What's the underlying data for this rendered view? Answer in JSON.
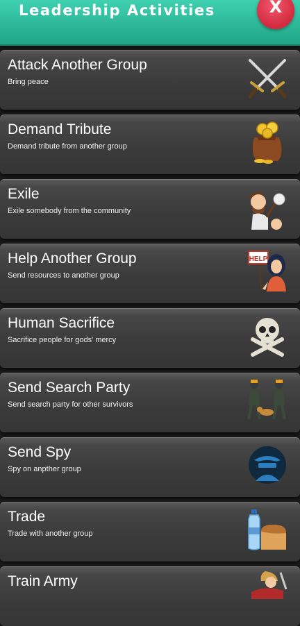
{
  "header": {
    "title": "Leadership Activities",
    "close_label": "X"
  },
  "activities": [
    {
      "title": "Attack Another Group",
      "description": "Bring peace",
      "icon": "crossed-swords-icon"
    },
    {
      "title": "Demand Tribute",
      "description": "Demand tribute from another group",
      "icon": "gold-sack-icon"
    },
    {
      "title": "Exile",
      "description": "Exile somebody from the community",
      "icon": "exiled-person-icon"
    },
    {
      "title": "Help Another Group",
      "description": "Send resources to another group",
      "icon": "help-sign-person-icon",
      "icon_text": "HELP"
    },
    {
      "title": "Human Sacrifice",
      "description": "Sacrifice people for gods' mercy",
      "icon": "skull-crossbones-icon"
    },
    {
      "title": "Send Search Party",
      "description": "Send search party for other survivors",
      "icon": "search-party-icon"
    },
    {
      "title": "Send Spy",
      "description": "Spy on anpther group",
      "icon": "spy-icon"
    },
    {
      "title": "Trade",
      "description": "Trade with another group",
      "icon": "water-bread-icon"
    },
    {
      "title": "Train Army",
      "description": "",
      "icon": "warrior-icon"
    }
  ],
  "colors": {
    "header": "#2bbf9e",
    "close": "#e0354a",
    "card": "#3b3b3b"
  }
}
